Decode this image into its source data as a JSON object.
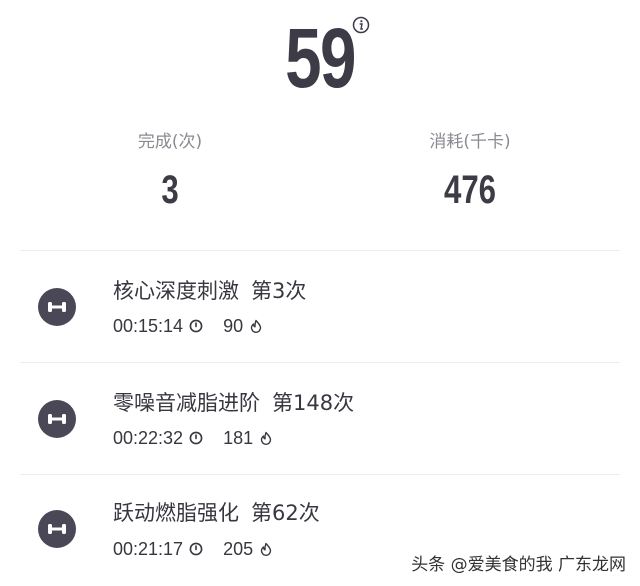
{
  "summary": {
    "total": "59"
  },
  "stats": {
    "completed_label": "完成(次)",
    "completed_value": "3",
    "calories_label": "消耗(千卡)",
    "calories_value": "476"
  },
  "workouts": [
    {
      "name": "核心深度刺激",
      "count": "第3次",
      "duration": "00:15:14",
      "calories": "90"
    },
    {
      "name": "零噪音减脂进阶",
      "count": "第148次",
      "duration": "00:22:32",
      "calories": "181"
    },
    {
      "name": "跃动燃脂强化",
      "count": "第62次",
      "duration": "00:21:17",
      "calories": "205"
    }
  ],
  "watermark": "头条 @爱美食的我 广东龙网"
}
